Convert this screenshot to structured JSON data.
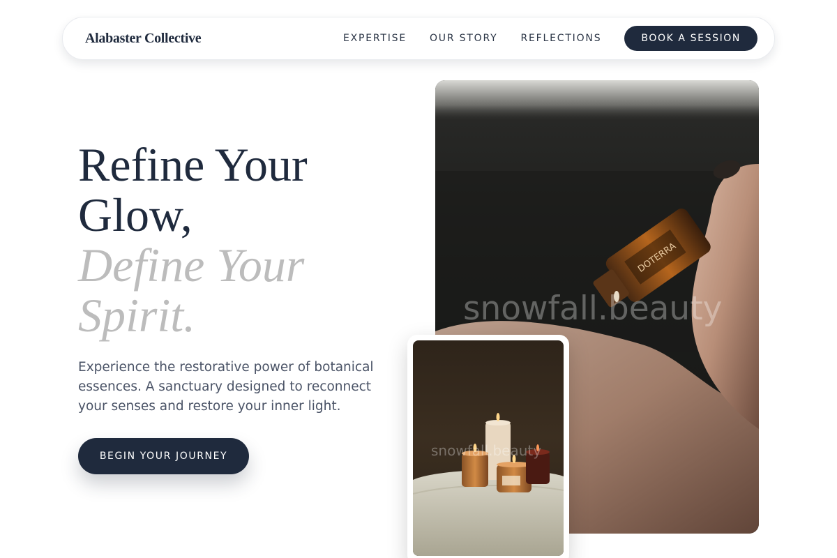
{
  "nav": {
    "brand": "Alabaster Collective",
    "links": [
      "EXPERTISE",
      "OUR STORY",
      "REFLECTIONS"
    ],
    "cta_label": "BOOK A SESSION"
  },
  "hero": {
    "title_lines": [
      "Refine Your",
      "Glow,"
    ],
    "accent_lines": [
      "Define Your",
      "Spirit."
    ],
    "description": "Experience the restorative power of botanical essences. A sanctuary designed to reconnect your senses and restore your inner light.",
    "cta_label": "BEGIN YOUR JOURNEY"
  },
  "images": {
    "main": {
      "subject": "hand-holding-essential-oil-bottle",
      "bottle_label": "DOTERRA",
      "watermark": "snowfall.beauty"
    },
    "secondary": {
      "subject": "candles-on-table",
      "watermark": "snowfall.beauty"
    }
  },
  "colors": {
    "primary": "#1f2a3d",
    "accent_text": "#bcbcbc",
    "body_text": "#4a5366",
    "background": "#ffffff"
  }
}
